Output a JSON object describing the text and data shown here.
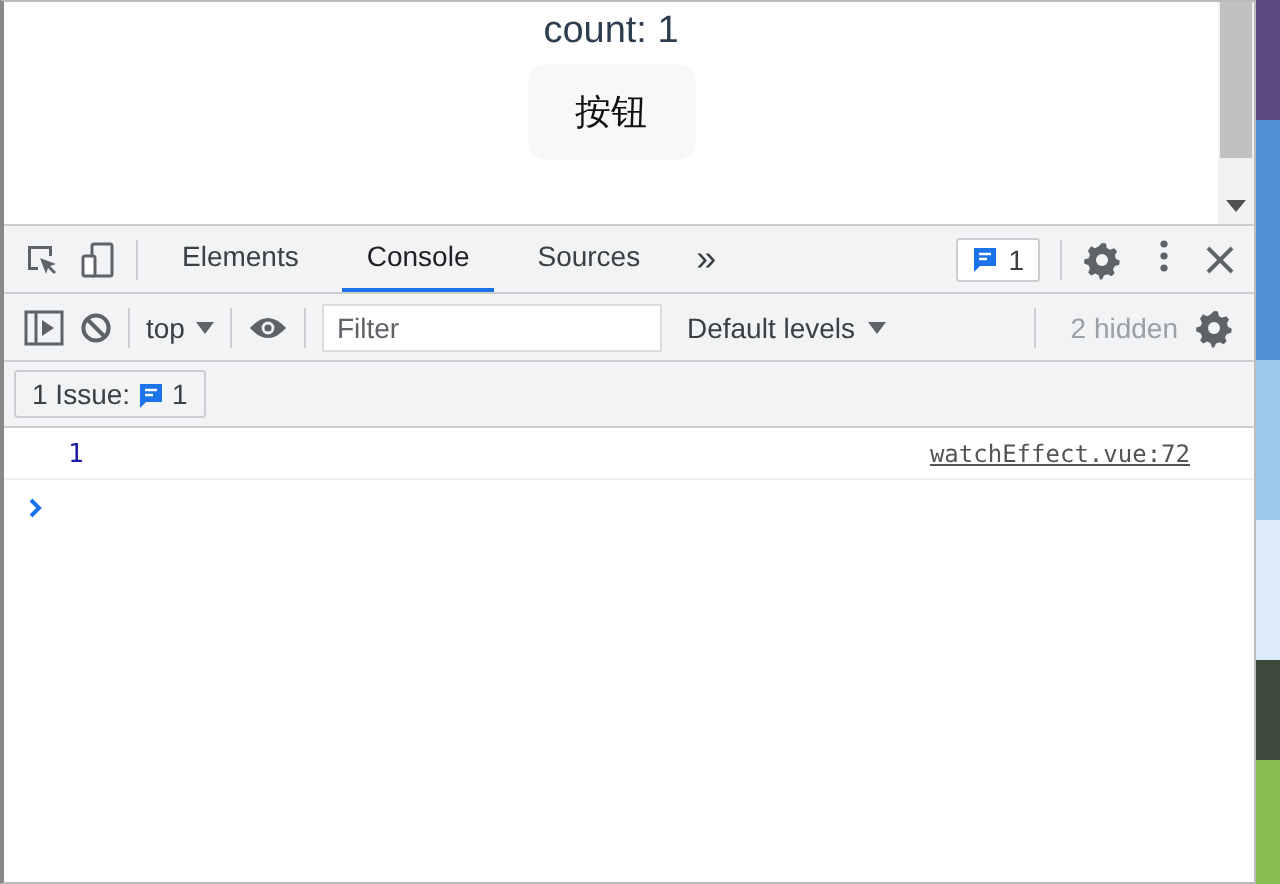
{
  "page": {
    "count_text": "count: 1",
    "button": "按钮"
  },
  "devtools": {
    "tabs": [
      {
        "label": "Elements",
        "selected": false
      },
      {
        "label": "Console",
        "selected": true
      },
      {
        "label": "Sources",
        "selected": false
      }
    ],
    "more_tabs": "»",
    "message_badge": "1",
    "console_toolbar": {
      "context": "top",
      "filter": {
        "placeholder": "Filter"
      },
      "levels": "Default levels",
      "hidden": "2 hidden"
    },
    "issues": {
      "label": "1 Issue:",
      "count": "1"
    },
    "logs": [
      {
        "message": "1",
        "source": "watchEffect.vue:72"
      }
    ]
  }
}
